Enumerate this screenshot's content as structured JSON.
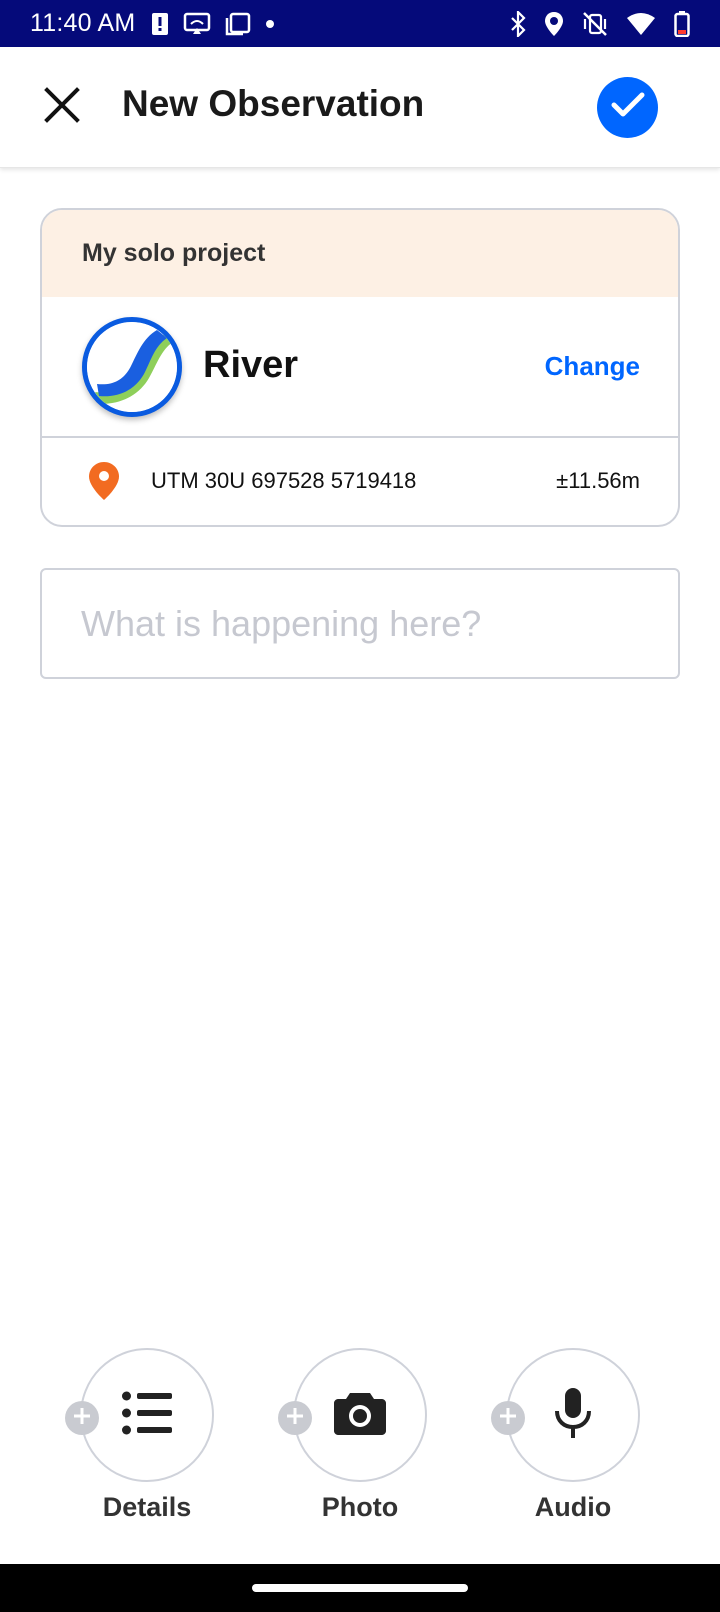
{
  "status_bar": {
    "time": "11:40 AM",
    "left_icons": [
      "alert-icon",
      "cast-icon",
      "screenshot-icon",
      "dot-icon"
    ],
    "right_icons": [
      "bluetooth-icon",
      "location-icon",
      "vibrate-off-icon",
      "wifi-icon",
      "battery-icon"
    ]
  },
  "app_bar": {
    "title": "New Observation",
    "close_icon": "close-icon",
    "confirm_icon": "check-icon",
    "accent_color": "#0066ff"
  },
  "observation": {
    "project_name": "My solo project",
    "category": {
      "name": "River",
      "icon": "river-icon",
      "change_label": "Change"
    },
    "location": {
      "coordinates": "UTM 30U 697528 5719418",
      "accuracy": "±11.56m",
      "pin_color": "#f26b21"
    }
  },
  "notes": {
    "placeholder": "What is happening here?",
    "value": ""
  },
  "actions": [
    {
      "label": "Details",
      "icon": "list-icon"
    },
    {
      "label": "Photo",
      "icon": "camera-icon"
    },
    {
      "label": "Audio",
      "icon": "microphone-icon"
    }
  ]
}
